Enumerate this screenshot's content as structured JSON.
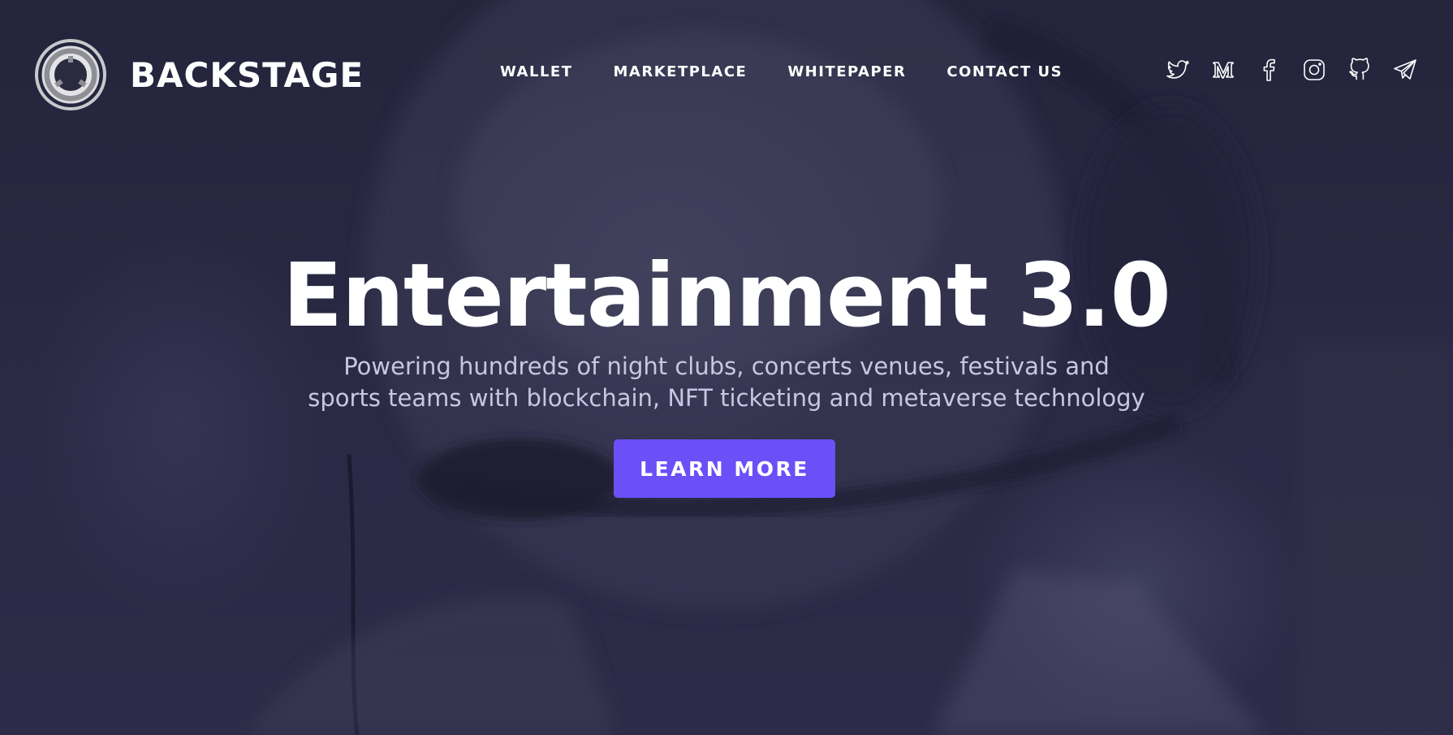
{
  "brand": {
    "name": "BACKSTAGE",
    "logo_icon": "backstage-ring-logo"
  },
  "nav": {
    "items": [
      {
        "label": "WALLET"
      },
      {
        "label": "MARKETPLACE"
      },
      {
        "label": "WHITEPAPER"
      },
      {
        "label": "CONTACT US"
      }
    ]
  },
  "socials": [
    {
      "icon": "twitter-icon"
    },
    {
      "icon": "medium-icon"
    },
    {
      "icon": "facebook-icon"
    },
    {
      "icon": "instagram-icon"
    },
    {
      "icon": "github-icon"
    },
    {
      "icon": "telegram-icon"
    }
  ],
  "hero": {
    "headline": "Entertainment 3.0",
    "subtext_line1": "Powering hundreds of night clubs, concerts venues, festivals and",
    "subtext_line2": "sports teams with blockchain, NFT ticketing and metaverse technology",
    "cta_label": "LEARN MORE"
  },
  "colors": {
    "background": "#262640",
    "accent": "#6b4ff7",
    "subtext": "#c9c6e2",
    "text": "#ffffff"
  }
}
